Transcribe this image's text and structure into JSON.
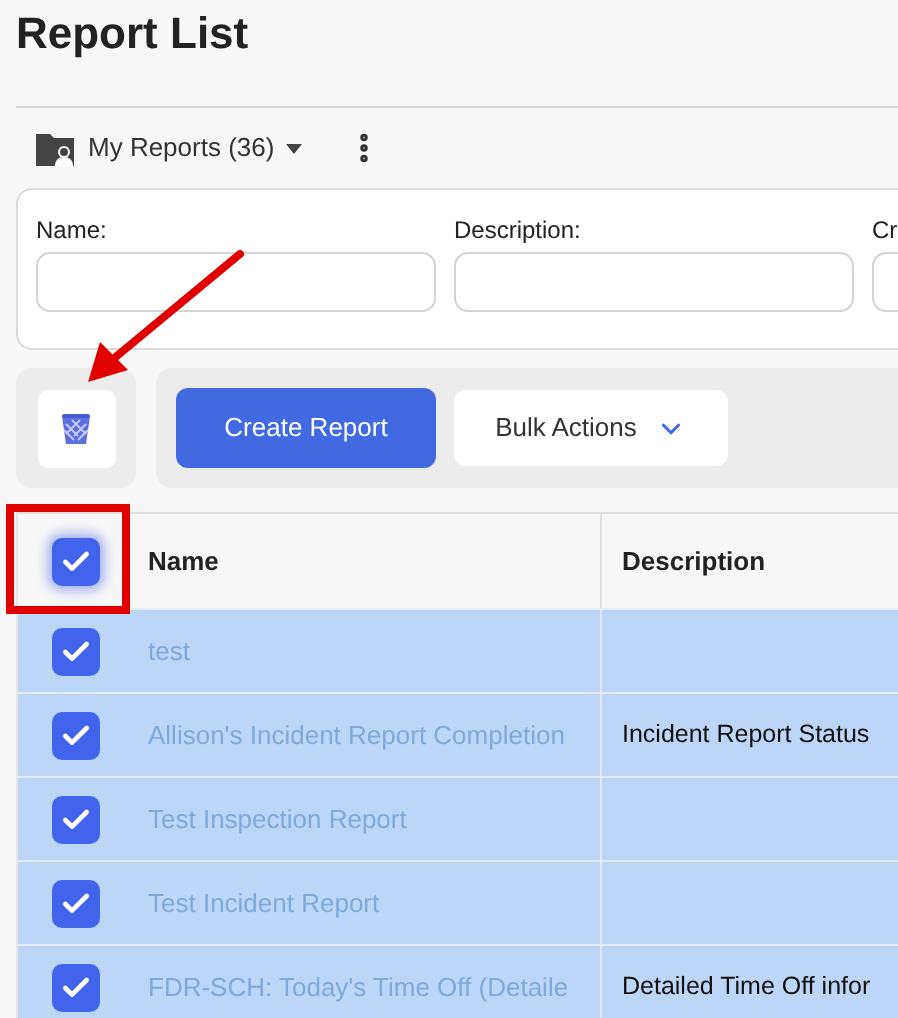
{
  "page_title": "Report List",
  "folder_menu": {
    "label": "My Reports (36)"
  },
  "filters": [
    {
      "label": "Name:"
    },
    {
      "label": "Description:"
    },
    {
      "label": "Cr"
    }
  ],
  "actions": {
    "create": "Create Report",
    "bulk": "Bulk Actions"
  },
  "table": {
    "select_all_checked": true,
    "columns": [
      "Name",
      "Description"
    ],
    "rows": [
      {
        "name": "test",
        "checked": true
      },
      {
        "name": "Allison's Incident Report Completion",
        "description": "Incident Report Status",
        "checked": true
      },
      {
        "name": "Test Inspection Report",
        "checked": true
      },
      {
        "name": "Test Incident Report",
        "checked": true
      },
      {
        "name": "FDR-SCH: Today's Time Off (Detaile",
        "description": "Detailed Time Off infor",
        "checked": true
      }
    ]
  }
}
